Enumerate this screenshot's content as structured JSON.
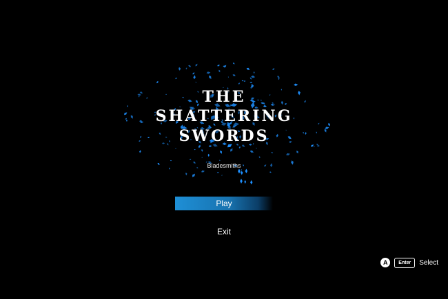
{
  "title": {
    "line1": "THE",
    "line2": "SHATTERING",
    "line3": "SWORDS"
  },
  "subtitle": "Bladesmiths",
  "menu": {
    "items": [
      {
        "label": "Play",
        "selected": true
      },
      {
        "label": "Exit",
        "selected": false
      }
    ]
  },
  "hints": {
    "gamepad_button": "A",
    "keyboard_key": "Enter",
    "action": "Select"
  },
  "colors": {
    "background": "#000000",
    "shard": "#1e90ff",
    "selection": "#1e8fd6",
    "text": "#ffffff"
  }
}
